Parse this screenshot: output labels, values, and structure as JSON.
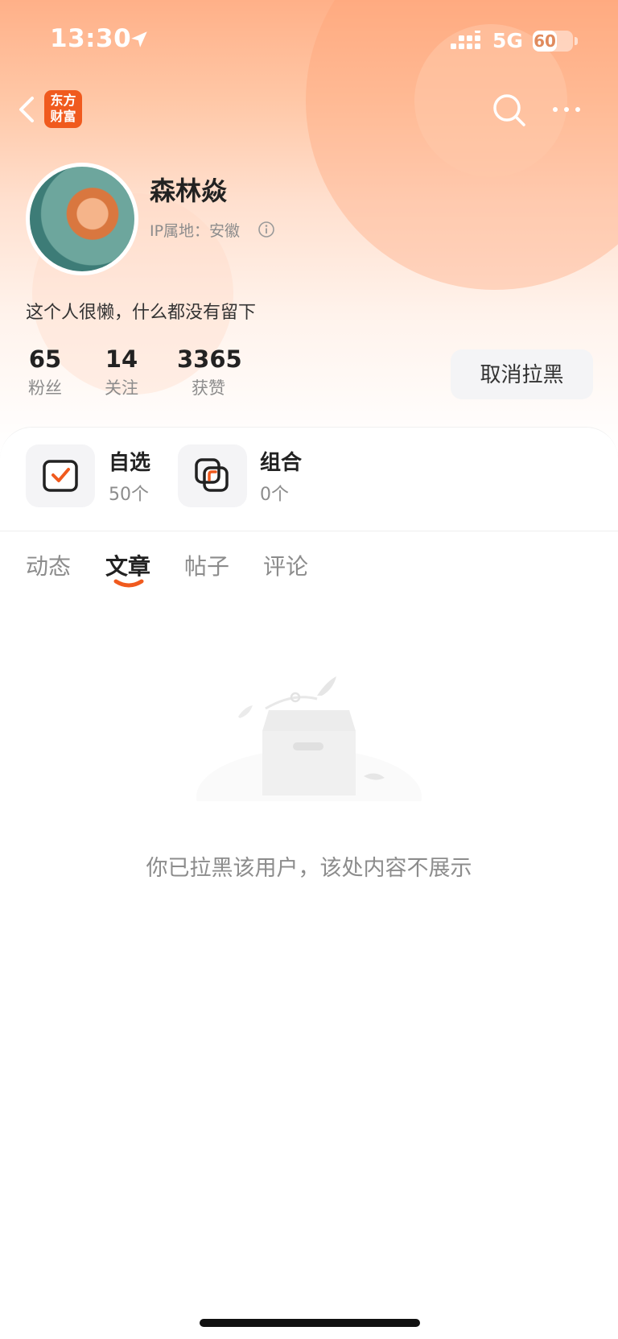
{
  "status_bar": {
    "time": "13:30",
    "network": "5G",
    "battery": "60",
    "battery_level_percent": 60
  },
  "header": {
    "logo_text_line1": "东方",
    "logo_text_line2": "财富",
    "icons": [
      "back-icon",
      "search-icon",
      "more-icon"
    ]
  },
  "profile": {
    "username": "森林焱",
    "ip_location": "IP属地：安徽",
    "bio": "这个人很懒，什么都没有留下",
    "stats": [
      {
        "value": "65",
        "label": "粉丝"
      },
      {
        "value": "14",
        "label": "关注"
      },
      {
        "value": "3365",
        "label": "获赞"
      }
    ],
    "unblock_label": "取消拉黑"
  },
  "portfolio": [
    {
      "title": "自选",
      "count": "50个",
      "icon": "watchlist-check-icon"
    },
    {
      "title": "组合",
      "count": "0个",
      "icon": "combo-squares-icon"
    }
  ],
  "tabs": {
    "items": [
      "动态",
      "文章",
      "帖子",
      "评论"
    ],
    "active_index": 1
  },
  "empty_state": {
    "message": "你已拉黑该用户，该处内容不展示",
    "icon": "empty-box-icon"
  },
  "colors": {
    "accent": "#f05a1e",
    "hero_top": "#ffb088",
    "text_primary": "#222222",
    "text_secondary": "#8c8c8c"
  }
}
